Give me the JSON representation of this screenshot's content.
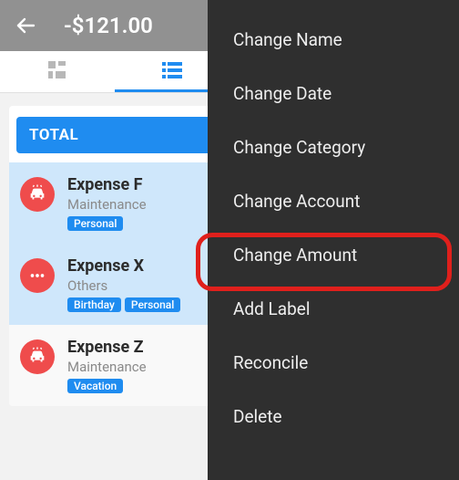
{
  "header": {
    "amount": "-$121.00"
  },
  "total_label": "TOTAL",
  "rows": [
    {
      "icon": "car",
      "title": "Expense F",
      "sub": "Maintenance",
      "tags": [
        "Personal"
      ],
      "selected": true
    },
    {
      "icon": "dots",
      "title": "Expense X",
      "sub": "Others",
      "tags": [
        "Birthday",
        "Personal"
      ],
      "selected": true
    },
    {
      "icon": "car",
      "title": "Expense Z",
      "sub": "Maintenance",
      "tags": [
        "Vacation"
      ],
      "selected": false
    }
  ],
  "menu": {
    "items": [
      "Change Name",
      "Change Date",
      "Change Category",
      "Change Account",
      "Change Amount",
      "Add Label",
      "Reconcile",
      "Delete"
    ],
    "highlighted_index": 4
  }
}
